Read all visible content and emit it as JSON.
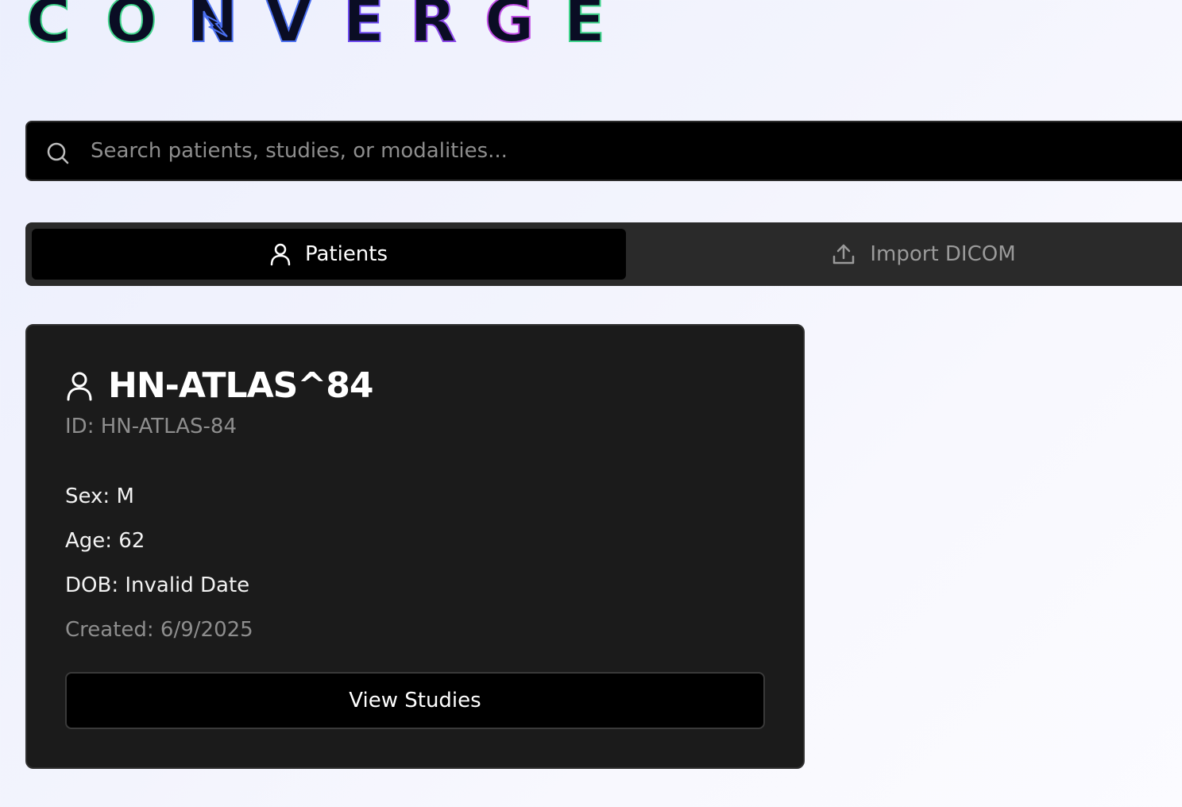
{
  "brand": {
    "letters": [
      "C",
      "O",
      "N",
      "V",
      "E",
      "R",
      "G",
      "E"
    ],
    "colors": {
      "green": "#3fd48b",
      "blue": "#4a6ff0",
      "violet": "#6e4bf0",
      "purple": "#8b48e8",
      "magenta": "#c14de6",
      "fill": "#0a0d24"
    }
  },
  "search": {
    "icon": "search-icon",
    "placeholder": "Search patients, studies, or modalities...",
    "value": ""
  },
  "tabs": [
    {
      "label": "Patients",
      "icon": "user-icon",
      "active": true
    },
    {
      "label": "Import DICOM",
      "icon": "upload-icon",
      "active": false
    }
  ],
  "patient_card": {
    "icon": "user-icon",
    "name": "HN-ATLAS^84",
    "id_text": "ID: HN-ATLAS-84",
    "sex": "Sex: M",
    "age": "Age: 62",
    "dob": "DOB: Invalid Date",
    "created": "Created: 6/9/2025",
    "button_label": "View Studies"
  },
  "theme": {
    "page_bg": "#eef0fd",
    "panel_bg": "#1b1b1b",
    "input_bg": "#000000",
    "text_primary": "#ffffff",
    "text_muted": "#8e8e8e"
  }
}
